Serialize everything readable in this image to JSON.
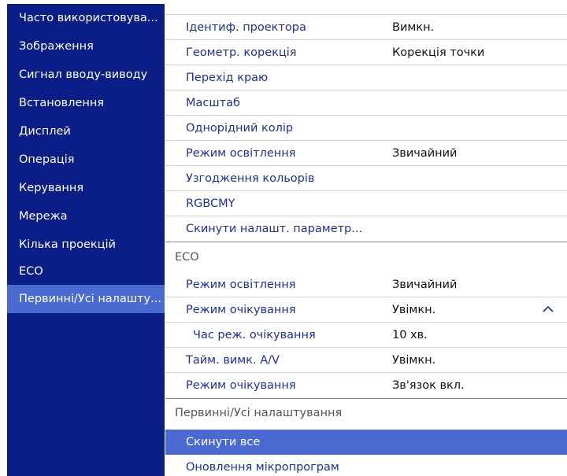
{
  "sidebar": {
    "items": [
      {
        "label": "Часто використовува..."
      },
      {
        "label": "Зображення"
      },
      {
        "label": "Сигнал вводу-виводу"
      },
      {
        "label": "Встановлення"
      },
      {
        "label": "Дисплей"
      },
      {
        "label": "Операція"
      },
      {
        "label": "Керування"
      },
      {
        "label": "Мережа"
      },
      {
        "label": "Кілька проекцій"
      },
      {
        "label": "ECO"
      },
      {
        "label": "Первинні/Усі налашту..."
      }
    ],
    "active_index": 10
  },
  "main": {
    "group1": [
      {
        "label": "Ідентиф. проектора",
        "value": "Вимкн."
      },
      {
        "label": "Геометр. корекція",
        "value": "Корекція точки"
      },
      {
        "label": "Перехід краю",
        "value": ""
      },
      {
        "label": "Масштаб",
        "value": ""
      },
      {
        "label": "Однорідний колір",
        "value": ""
      },
      {
        "label": "Режим освітлення",
        "value": "Звичайний"
      },
      {
        "label": "Узгодження кольорів",
        "value": ""
      },
      {
        "label": "RGBCMY",
        "value": ""
      },
      {
        "label": "Скинути налашт. параметр...",
        "value": ""
      }
    ],
    "eco_header": "ECO",
    "eco_items": [
      {
        "label": "Режим освітлення",
        "value": "Звичайний"
      },
      {
        "label": "Режим очікування",
        "value": "Увімкн."
      },
      {
        "label": "Час реж. очікування",
        "value": "10 хв."
      },
      {
        "label": "Тайм. вимк. A/V",
        "value": "Увімкн."
      },
      {
        "label": "Режим очікування",
        "value": "Зв'язок вкл."
      }
    ],
    "init_header": "Первинні/Усі налаштування",
    "init_items": [
      {
        "label": "Скинути все"
      },
      {
        "label": "Оновлення мікропрограм"
      }
    ]
  },
  "colors": {
    "sidebar_bg": "#0b1e87",
    "selection": "#4a6ad2",
    "link_text": "#1b2fa8"
  },
  "icons": {
    "expand": "chevron-up-icon"
  }
}
